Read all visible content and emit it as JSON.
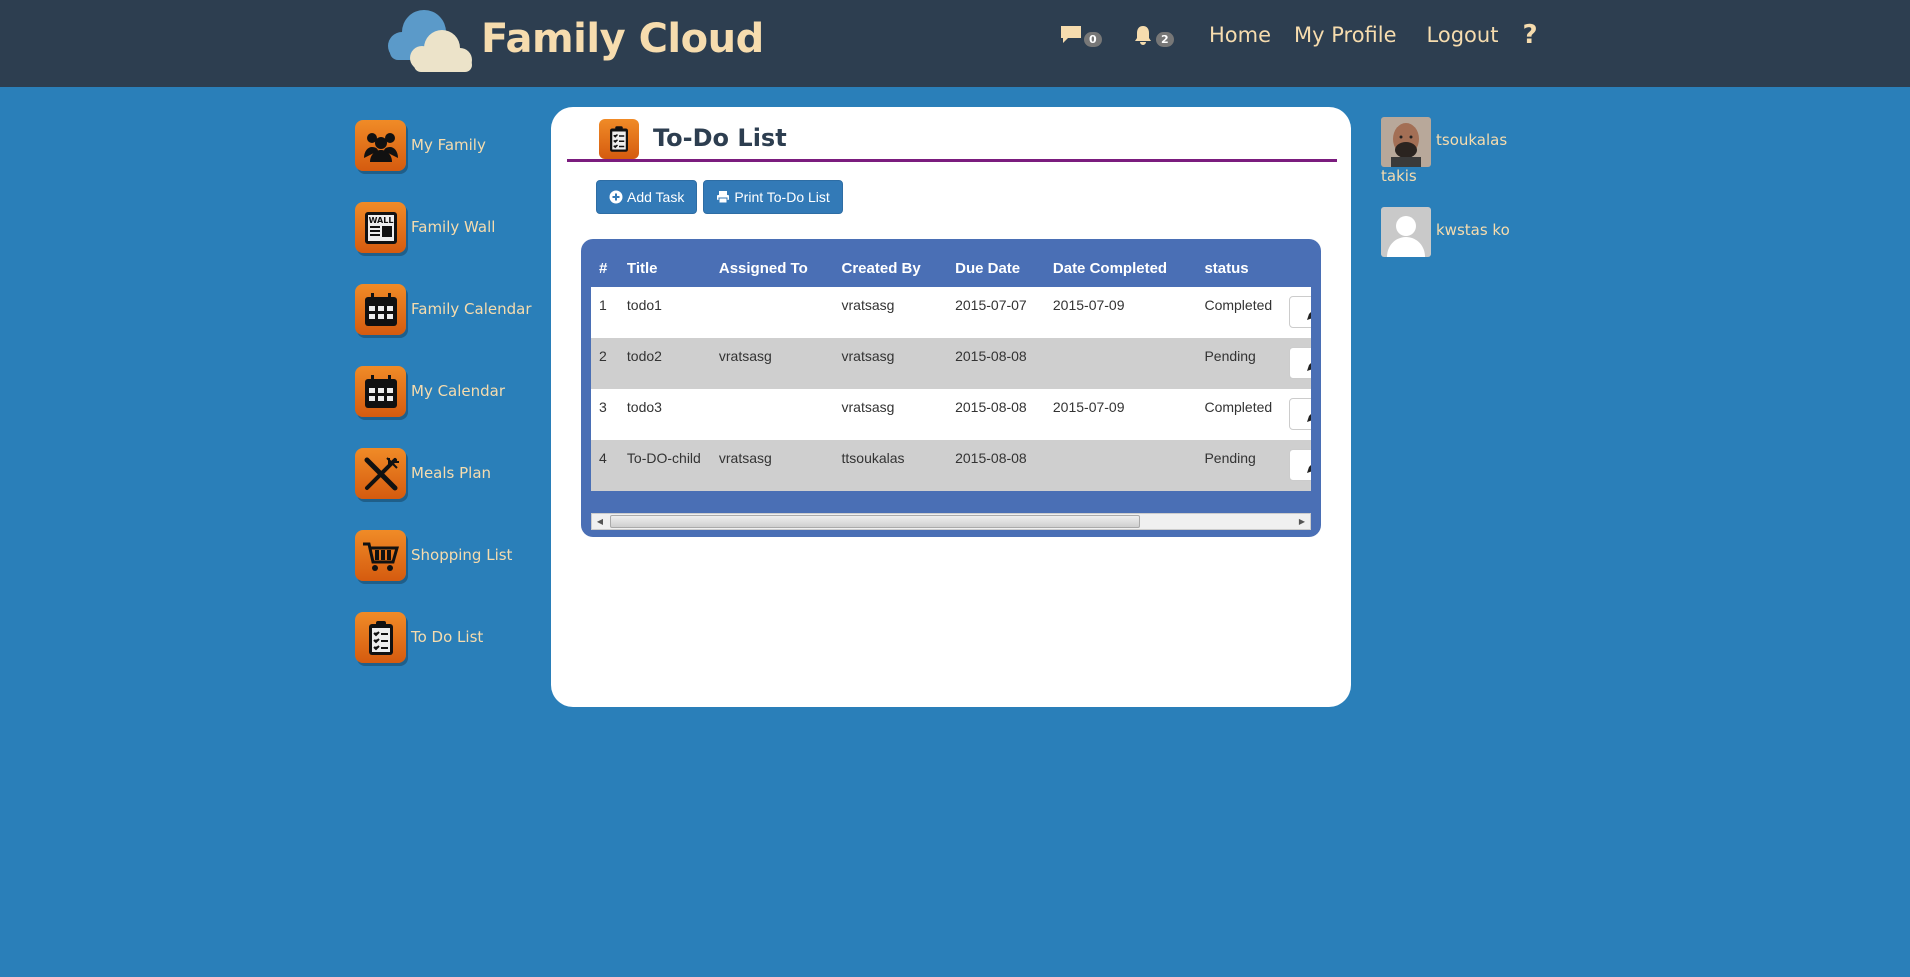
{
  "header": {
    "brand_title": "Family Cloud",
    "messages_count": "0",
    "notifications_count": "2",
    "nav": {
      "home": "Home",
      "profile": "My Profile",
      "logout": "Logout",
      "help": "?"
    }
  },
  "sidebar": {
    "items": [
      {
        "label": "My Family",
        "icon": "family-icon"
      },
      {
        "label": "Family Wall",
        "icon": "wall-icon"
      },
      {
        "label": "Family Calendar",
        "icon": "calendar-icon"
      },
      {
        "label": "My Calendar",
        "icon": "calendar-icon"
      },
      {
        "label": "Meals Plan",
        "icon": "fork-knife-icon"
      },
      {
        "label": "Shopping List",
        "icon": "cart-icon"
      },
      {
        "label": "To Do List",
        "icon": "clipboard-icon"
      }
    ]
  },
  "main": {
    "title": "To-Do List",
    "add_task_label": "Add Task",
    "print_label": "Print To-Do List",
    "table": {
      "headers": [
        "#",
        "Title",
        "Assigned To",
        "Created By",
        "Due Date",
        "Date Completed",
        "status"
      ],
      "rows": [
        {
          "num": "1",
          "title": "todo1",
          "assigned": "",
          "created": "vratsasg",
          "due": "2015-07-07",
          "completed": "2015-07-09",
          "status": "Completed"
        },
        {
          "num": "2",
          "title": "todo2",
          "assigned": "vratsasg",
          "created": "vratsasg",
          "due": "2015-08-08",
          "completed": "",
          "status": "Pending"
        },
        {
          "num": "3",
          "title": "todo3",
          "assigned": "",
          "created": "vratsasg",
          "due": "2015-08-08",
          "completed": "2015-07-09",
          "status": "Completed"
        },
        {
          "num": "4",
          "title": "To-DO-child",
          "assigned": "vratsasg",
          "created": "ttsoukalas",
          "due": "2015-08-08",
          "completed": "",
          "status": "Pending"
        }
      ]
    }
  },
  "members": [
    {
      "name": "tsoukalas",
      "name_line2": "takis"
    },
    {
      "name": "kwstas ko",
      "name_line2": ""
    }
  ],
  "colors": {
    "background": "#2a7fb9",
    "header": "#2d3e50",
    "accent_text": "#f6dcae",
    "icon_orange": "#e8731b",
    "title_underline": "#7b1c7e",
    "table_frame": "#4a6fb5",
    "button": "#337ab7"
  }
}
